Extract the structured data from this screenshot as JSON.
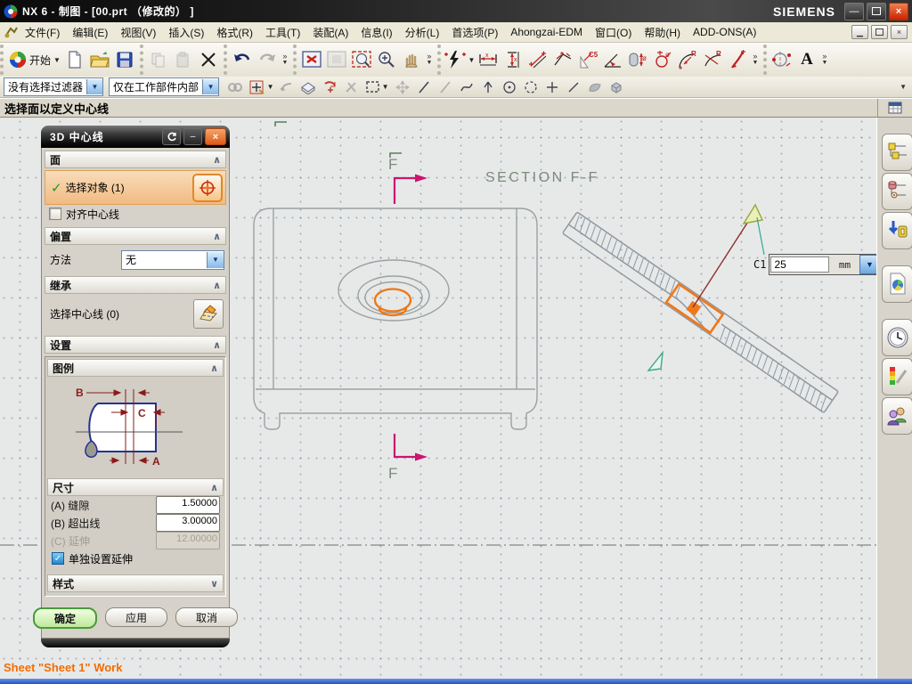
{
  "colors": {
    "highlight_orange": "#f07818",
    "section_arrow_magenta": "#cc1470",
    "annotation_green": "#7c8a7c",
    "ok_green": "#4a9a3a",
    "status_orange": "#f26a00"
  },
  "title_bar": {
    "title": "NX 6 - 制图 - [00.prt （修改的） ]",
    "brand": "SIEMENS"
  },
  "menu_bar": {
    "items": [
      {
        "label": "文件(F)"
      },
      {
        "label": "编辑(E)"
      },
      {
        "label": "视图(V)"
      },
      {
        "label": "插入(S)"
      },
      {
        "label": "格式(R)"
      },
      {
        "label": "工具(T)"
      },
      {
        "label": "装配(A)"
      },
      {
        "label": "信息(I)"
      },
      {
        "label": "分析(L)"
      },
      {
        "label": "首选项(P)"
      },
      {
        "label": "Ahongzai-EDM"
      },
      {
        "label": "窗口(O)"
      },
      {
        "label": "帮助(H)"
      },
      {
        "label": "ADD-ONS(A)"
      }
    ]
  },
  "toolbar": {
    "start_label": "开始",
    "text_tool_label": "A",
    "chamfer_label": "C5"
  },
  "selection_bar": {
    "filter_value": "没有选择过滤器",
    "scope_value": "仅在工作部件内部"
  },
  "prompt_bar": {
    "message": "选择面以定义中心线"
  },
  "dialog": {
    "title": "3D 中心线",
    "sections": {
      "face": "面",
      "offset": "偏置",
      "inherit": "继承",
      "settings": "设置",
      "legend": "图例",
      "dimension": "尺寸",
      "style": "样式"
    },
    "select_object": "选择对象 (1)",
    "align_centerline": "对齐中心线",
    "method_label": "方法",
    "method_value": "无",
    "select_centerline": "选择中心线 (0)",
    "legend_labels": {
      "a": "A",
      "b": "B",
      "c": "C"
    },
    "dim_rows": [
      {
        "label": "(A) 缝隙",
        "value": "1.50000"
      },
      {
        "label": "(B) 超出线",
        "value": "3.00000"
      },
      {
        "label": "(C) 延伸",
        "value": "12.00000"
      }
    ],
    "individual_extension": "单独设置延伸",
    "buttons": {
      "ok": "确定",
      "apply": "应用",
      "cancel": "取消"
    }
  },
  "drawing": {
    "section_title": "SECTION F-F",
    "section_arrow_label_top": "F",
    "section_arrow_label_bottom": "F",
    "c1": {
      "label": "C1",
      "value": "25",
      "unit": "mm"
    },
    "status": "Sheet \"Sheet 1\" Work"
  }
}
